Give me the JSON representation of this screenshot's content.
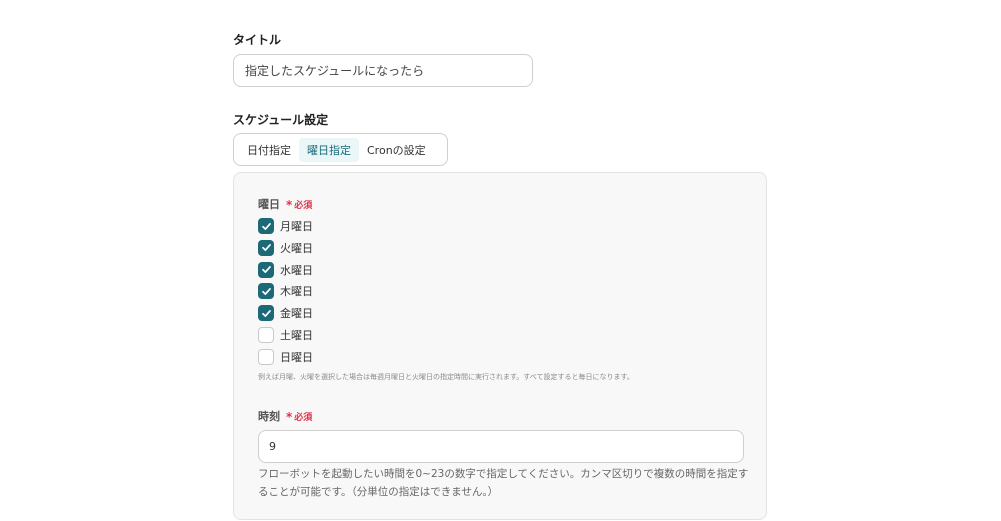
{
  "title_section": {
    "label": "タイトル",
    "value": "指定したスケジュールになったら"
  },
  "schedule": {
    "label": "スケジュール設定",
    "tabs": [
      {
        "label": "日付指定",
        "active": false
      },
      {
        "label": "曜日指定",
        "active": true
      },
      {
        "label": "Cronの設定",
        "active": false
      }
    ]
  },
  "weekday": {
    "label": "曜日",
    "required": "必須",
    "required_mark": "*",
    "items": [
      {
        "label": "月曜日",
        "checked": true
      },
      {
        "label": "火曜日",
        "checked": true
      },
      {
        "label": "水曜日",
        "checked": true
      },
      {
        "label": "木曜日",
        "checked": true
      },
      {
        "label": "金曜日",
        "checked": true
      },
      {
        "label": "土曜日",
        "checked": false
      },
      {
        "label": "日曜日",
        "checked": false
      }
    ],
    "hint": "例えば月曜、火曜を選択した場合は毎週月曜日と火曜日の指定時間に実行されます。すべて設定すると毎日になります。"
  },
  "time": {
    "label": "時刻",
    "required": "必須",
    "required_mark": "*",
    "value": "9",
    "hint": "フローボットを起動したい時間を0~23の数字で指定してください。カンマ区切りで複数の時間を指定することが可能です。（分単位の指定はできません。）"
  },
  "colors": {
    "accent": "#1c6a78",
    "required": "#e0334a",
    "active_tab_bg": "#eaf6f7"
  }
}
